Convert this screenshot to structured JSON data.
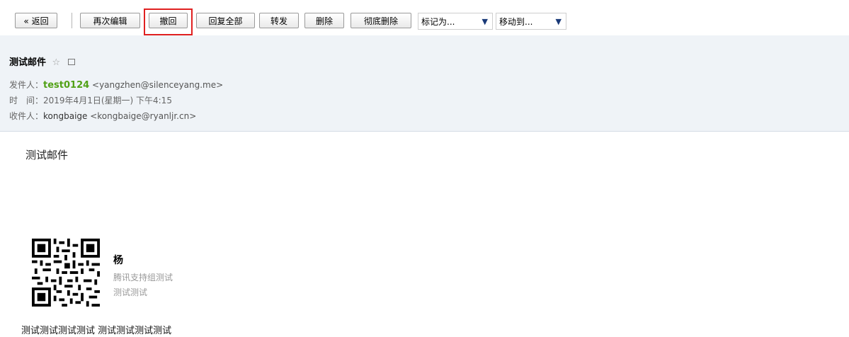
{
  "toolbar": {
    "back": "« 返回",
    "reedit": "再次编辑",
    "recall": "撤回",
    "reply_all": "回复全部",
    "forward": "转发",
    "delete": "删除",
    "delete_permanently": "彻底删除",
    "mark_as": "标记为...",
    "move_to": "移动到..."
  },
  "mail": {
    "subject": "测试邮件",
    "from_label": "发件人：",
    "from_name": "test0124",
    "from_email": "<yangzhen@silenceyang.me>",
    "time_label": "时　间：",
    "time_value": "2019年4月1日(星期一) 下午4:15",
    "to_label": "收件人：",
    "to_name": "kongbaige",
    "to_email": "<kongbaige@ryanljr.cn>",
    "body": "测试邮件"
  },
  "signature": {
    "name": "杨",
    "line1": "腾讯支持组测试",
    "line2": "测试测试",
    "footer": "测试测试测试测试 测试测试测试测试"
  },
  "colors": {
    "highlight": "#e02020",
    "sender": "#51a116",
    "header_bg": "#eff3f7"
  }
}
